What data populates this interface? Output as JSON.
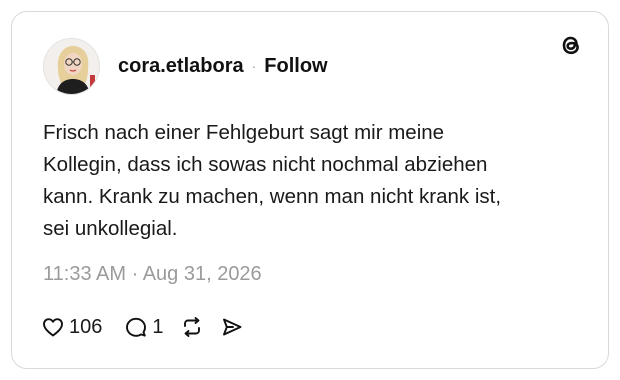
{
  "post": {
    "username": "cora.etlabora",
    "separator": "·",
    "follow_label": "Follow",
    "text_lines": [
      "Frisch nach einer Fehlgeburt sagt mir meine",
      "Kollegin, dass ich sowas nicht nochmal abziehen",
      "kann. Krank zu machen, wenn man nicht krank ist,",
      "sei unkollegial."
    ],
    "timestamp": "11:33 AM · Aug 31, 2026",
    "likes": "106",
    "replies": "1"
  },
  "icons": {
    "brand": "threads-logo-icon",
    "like": "heart-icon",
    "reply": "speech-bubble-icon",
    "repost": "repost-icon",
    "share": "send-icon"
  },
  "colors": {
    "text": "#111111",
    "muted": "#9b9b9b",
    "border": "#d9d9d9"
  }
}
